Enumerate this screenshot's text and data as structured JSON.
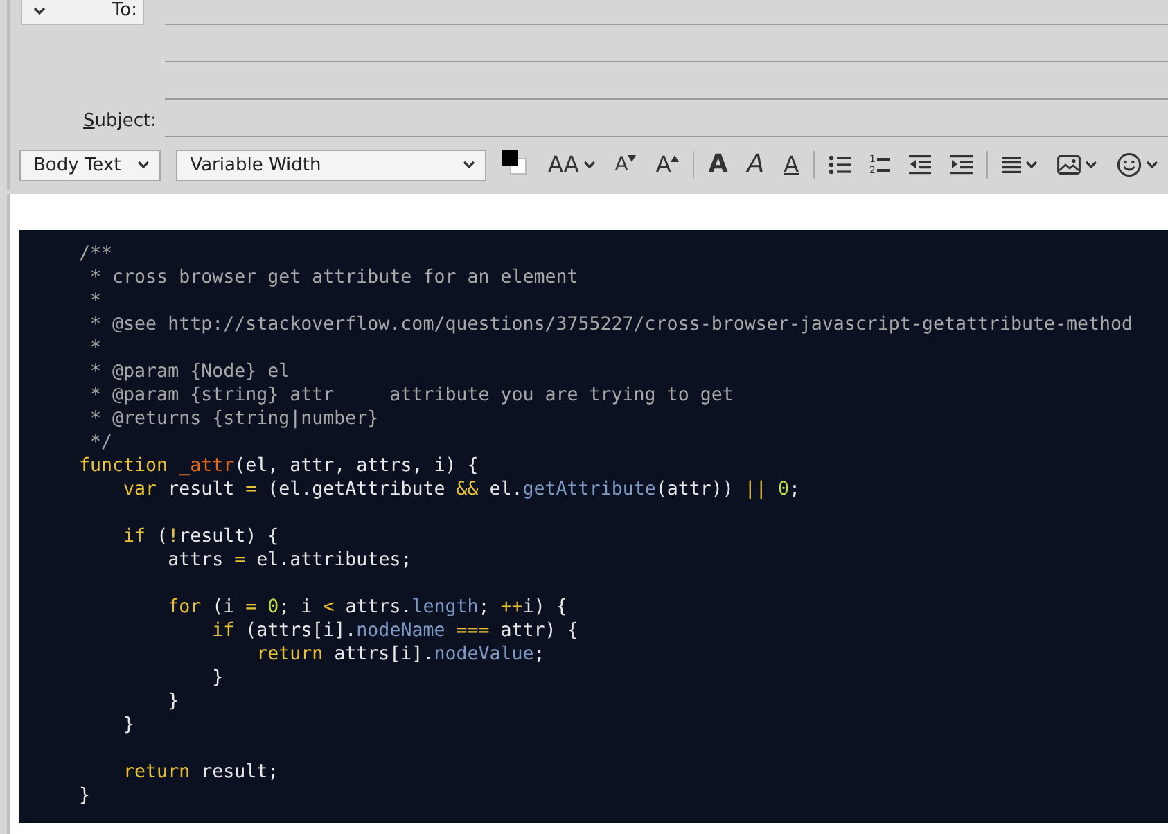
{
  "header": {
    "fields": [
      {
        "kind": "to",
        "label": "To:",
        "underline_first": false
      },
      {
        "kind": "blank"
      },
      {
        "kind": "blank"
      },
      {
        "kind": "subject",
        "label": "Subject:",
        "underline_first": true
      }
    ]
  },
  "toolbar": {
    "paragraph_style": "Body Text",
    "font": "Variable Width",
    "buttons": [
      {
        "kind": "font-size",
        "text": "AA",
        "menu": true
      },
      {
        "kind": "shrink",
        "text": "A"
      },
      {
        "kind": "grow",
        "text": "A"
      },
      {
        "kind": "separator"
      },
      {
        "kind": "bold",
        "text": "A"
      },
      {
        "kind": "italic",
        "text": "A"
      },
      {
        "kind": "underline",
        "text": "A"
      },
      {
        "kind": "separator"
      },
      {
        "kind": "bullets"
      },
      {
        "kind": "numbering",
        "markers": [
          "1",
          "2"
        ]
      },
      {
        "kind": "outdent"
      },
      {
        "kind": "indent"
      },
      {
        "kind": "separator"
      },
      {
        "kind": "align",
        "menu": true
      },
      {
        "kind": "image",
        "menu": true
      },
      {
        "kind": "emoji",
        "menu": true
      }
    ]
  },
  "code": {
    "lines": [
      {
        "kind": "comment",
        "text": "    /**"
      },
      {
        "kind": "comment",
        "text": "     * cross browser get attribute for an element"
      },
      {
        "kind": "comment",
        "text": "     *"
      },
      {
        "kind": "comment",
        "text": "     * @see http://stackoverflow.com/questions/3755227/cross-browser-javascript-getattribute-method"
      },
      {
        "kind": "comment",
        "text": "     *"
      },
      {
        "kind": "comment",
        "text": "     * @param {Node} el"
      },
      {
        "kind": "comment",
        "text": "     * @param {string} attr     attribute you are trying to get"
      },
      {
        "kind": "comment",
        "text": "     * @returns {string|number}"
      },
      {
        "kind": "comment",
        "text": "     */"
      },
      {
        "kind": "code",
        "tokens": [
          {
            "kind": "keyword",
            "text": "    function "
          },
          {
            "kind": "function",
            "text": "_attr"
          },
          {
            "kind": "plain",
            "text": "(el, attr, attrs, i) {"
          }
        ]
      },
      {
        "kind": "code",
        "tokens": [
          {
            "kind": "keyword",
            "text": "        var"
          },
          {
            "kind": "plain",
            "text": " result "
          },
          {
            "kind": "operator",
            "text": "="
          },
          {
            "kind": "plain",
            "text": " (el.getAttribute "
          },
          {
            "kind": "operator",
            "text": "&&"
          },
          {
            "kind": "plain",
            "text": " el."
          },
          {
            "kind": "property",
            "text": "getAttribute"
          },
          {
            "kind": "plain",
            "text": "(attr)) "
          },
          {
            "kind": "operator",
            "text": "|| "
          },
          {
            "kind": "number",
            "text": "0"
          },
          {
            "kind": "plain",
            "text": ";"
          }
        ]
      },
      {
        "kind": "blank"
      },
      {
        "kind": "code",
        "tokens": [
          {
            "kind": "keyword",
            "text": "        if"
          },
          {
            "kind": "plain",
            "text": " ("
          },
          {
            "kind": "operator",
            "text": "!"
          },
          {
            "kind": "plain",
            "text": "result) {"
          }
        ]
      },
      {
        "kind": "code",
        "tokens": [
          {
            "kind": "plain",
            "text": "            attrs "
          },
          {
            "kind": "operator",
            "text": "="
          },
          {
            "kind": "plain",
            "text": " el.attributes;"
          }
        ]
      },
      {
        "kind": "blank"
      },
      {
        "kind": "code",
        "tokens": [
          {
            "kind": "keyword",
            "text": "            for"
          },
          {
            "kind": "plain",
            "text": " (i "
          },
          {
            "kind": "operator",
            "text": "= "
          },
          {
            "kind": "number",
            "text": "0"
          },
          {
            "kind": "plain",
            "text": "; i "
          },
          {
            "kind": "operator",
            "text": "<"
          },
          {
            "kind": "plain",
            "text": " attrs."
          },
          {
            "kind": "property",
            "text": "length"
          },
          {
            "kind": "plain",
            "text": "; "
          },
          {
            "kind": "operator",
            "text": "++"
          },
          {
            "kind": "plain",
            "text": "i) {"
          }
        ]
      },
      {
        "kind": "code",
        "tokens": [
          {
            "kind": "keyword",
            "text": "                if"
          },
          {
            "kind": "plain",
            "text": " (attrs[i]."
          },
          {
            "kind": "property",
            "text": "nodeName"
          },
          {
            "kind": "operator",
            "text": " ==="
          },
          {
            "kind": "plain",
            "text": " attr) {"
          }
        ]
      },
      {
        "kind": "code",
        "tokens": [
          {
            "kind": "keyword",
            "text": "                    return"
          },
          {
            "kind": "plain",
            "text": " attrs[i]."
          },
          {
            "kind": "property",
            "text": "nodeValue"
          },
          {
            "kind": "plain",
            "text": ";"
          }
        ]
      },
      {
        "kind": "code",
        "tokens": [
          {
            "kind": "plain",
            "text": "                }"
          }
        ]
      },
      {
        "kind": "code",
        "tokens": [
          {
            "kind": "plain",
            "text": "            }"
          }
        ]
      },
      {
        "kind": "code",
        "tokens": [
          {
            "kind": "plain",
            "text": "        }"
          }
        ]
      },
      {
        "kind": "blank"
      },
      {
        "kind": "code",
        "tokens": [
          {
            "kind": "keyword",
            "text": "        return"
          },
          {
            "kind": "plain",
            "text": " result;"
          }
        ]
      },
      {
        "kind": "code",
        "tokens": [
          {
            "kind": "plain",
            "text": "    }"
          }
        ]
      }
    ]
  }
}
